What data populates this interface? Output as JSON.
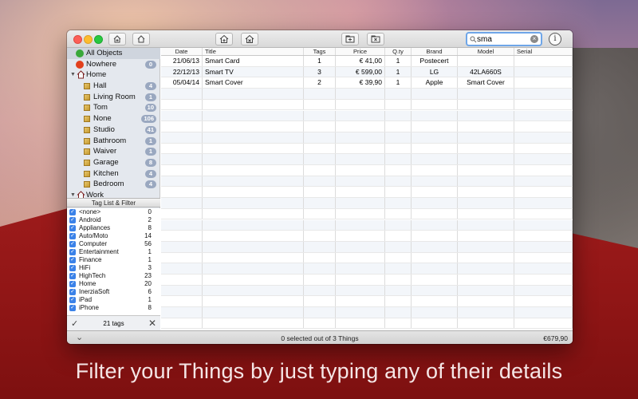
{
  "colors": {
    "accent": "#3b82e8",
    "badge": "#9aa8c0",
    "selection": "#cfd5de",
    "brand_red": "#a01c1c"
  },
  "toolbar": {
    "icons": [
      "add-thing-icon",
      "home-icon",
      "add-location-icon",
      "remove-location-icon",
      "add-folder-icon",
      "remove-folder-icon"
    ],
    "search_value": "sma",
    "info_label": "i"
  },
  "sidebar": {
    "items": [
      {
        "label": "All Objects",
        "kind": "all",
        "selected": true
      },
      {
        "label": "Nowhere",
        "kind": "nowhere",
        "count": "0"
      },
      {
        "label": "Home",
        "kind": "group",
        "expanded": true
      },
      {
        "label": "Hall",
        "kind": "room",
        "count": "4"
      },
      {
        "label": "Living Room",
        "kind": "room",
        "count": "1"
      },
      {
        "label": "Tom",
        "kind": "room",
        "count": "10"
      },
      {
        "label": "None",
        "kind": "room",
        "count": "106"
      },
      {
        "label": "Studio",
        "kind": "room",
        "count": "41"
      },
      {
        "label": "Bathroom",
        "kind": "room",
        "count": "1"
      },
      {
        "label": "Waiver",
        "kind": "room",
        "count": "1"
      },
      {
        "label": "Garage",
        "kind": "room",
        "count": "8"
      },
      {
        "label": "Kitchen",
        "kind": "room",
        "count": "4"
      },
      {
        "label": "Bedroom",
        "kind": "room",
        "count": "4"
      },
      {
        "label": "Work",
        "kind": "group",
        "expanded": true
      }
    ],
    "tag_header": "Tag List & Filter",
    "tags": [
      {
        "name": "<none>",
        "count": "0"
      },
      {
        "name": "Android",
        "count": "2"
      },
      {
        "name": "Appliances",
        "count": "8"
      },
      {
        "name": "Auto/Moto",
        "count": "14"
      },
      {
        "name": "Computer",
        "count": "56"
      },
      {
        "name": "Entertainment",
        "count": "1"
      },
      {
        "name": "Finance",
        "count": "1"
      },
      {
        "name": "HiFi",
        "count": "3"
      },
      {
        "name": "HighTech",
        "count": "23"
      },
      {
        "name": "Home",
        "count": "20"
      },
      {
        "name": "InerziaSoft",
        "count": "6"
      },
      {
        "name": "iPad",
        "count": "1"
      },
      {
        "name": "iPhone",
        "count": "8"
      }
    ],
    "tag_footer": "21 tags"
  },
  "table": {
    "columns": [
      "Date",
      "Title",
      "Tags",
      "Price",
      "Q.ty",
      "Brand",
      "Model",
      "Serial"
    ],
    "rows": [
      [
        "21/06/13",
        "Smart Card",
        "1",
        "€ 41,00",
        "1",
        "Postecert",
        "",
        ""
      ],
      [
        "22/12/13",
        "Smart TV",
        "3",
        "€ 599,00",
        "1",
        "LG",
        "42LA660S",
        ""
      ],
      [
        "05/04/14",
        "Smart Cover",
        "2",
        "€ 39,90",
        "1",
        "Apple",
        "Smart Cover",
        ""
      ]
    ]
  },
  "status": {
    "selection": "0 selected out of 3 Things",
    "total": "€679,90"
  },
  "caption": "Filter your Things by just typing any of their details"
}
